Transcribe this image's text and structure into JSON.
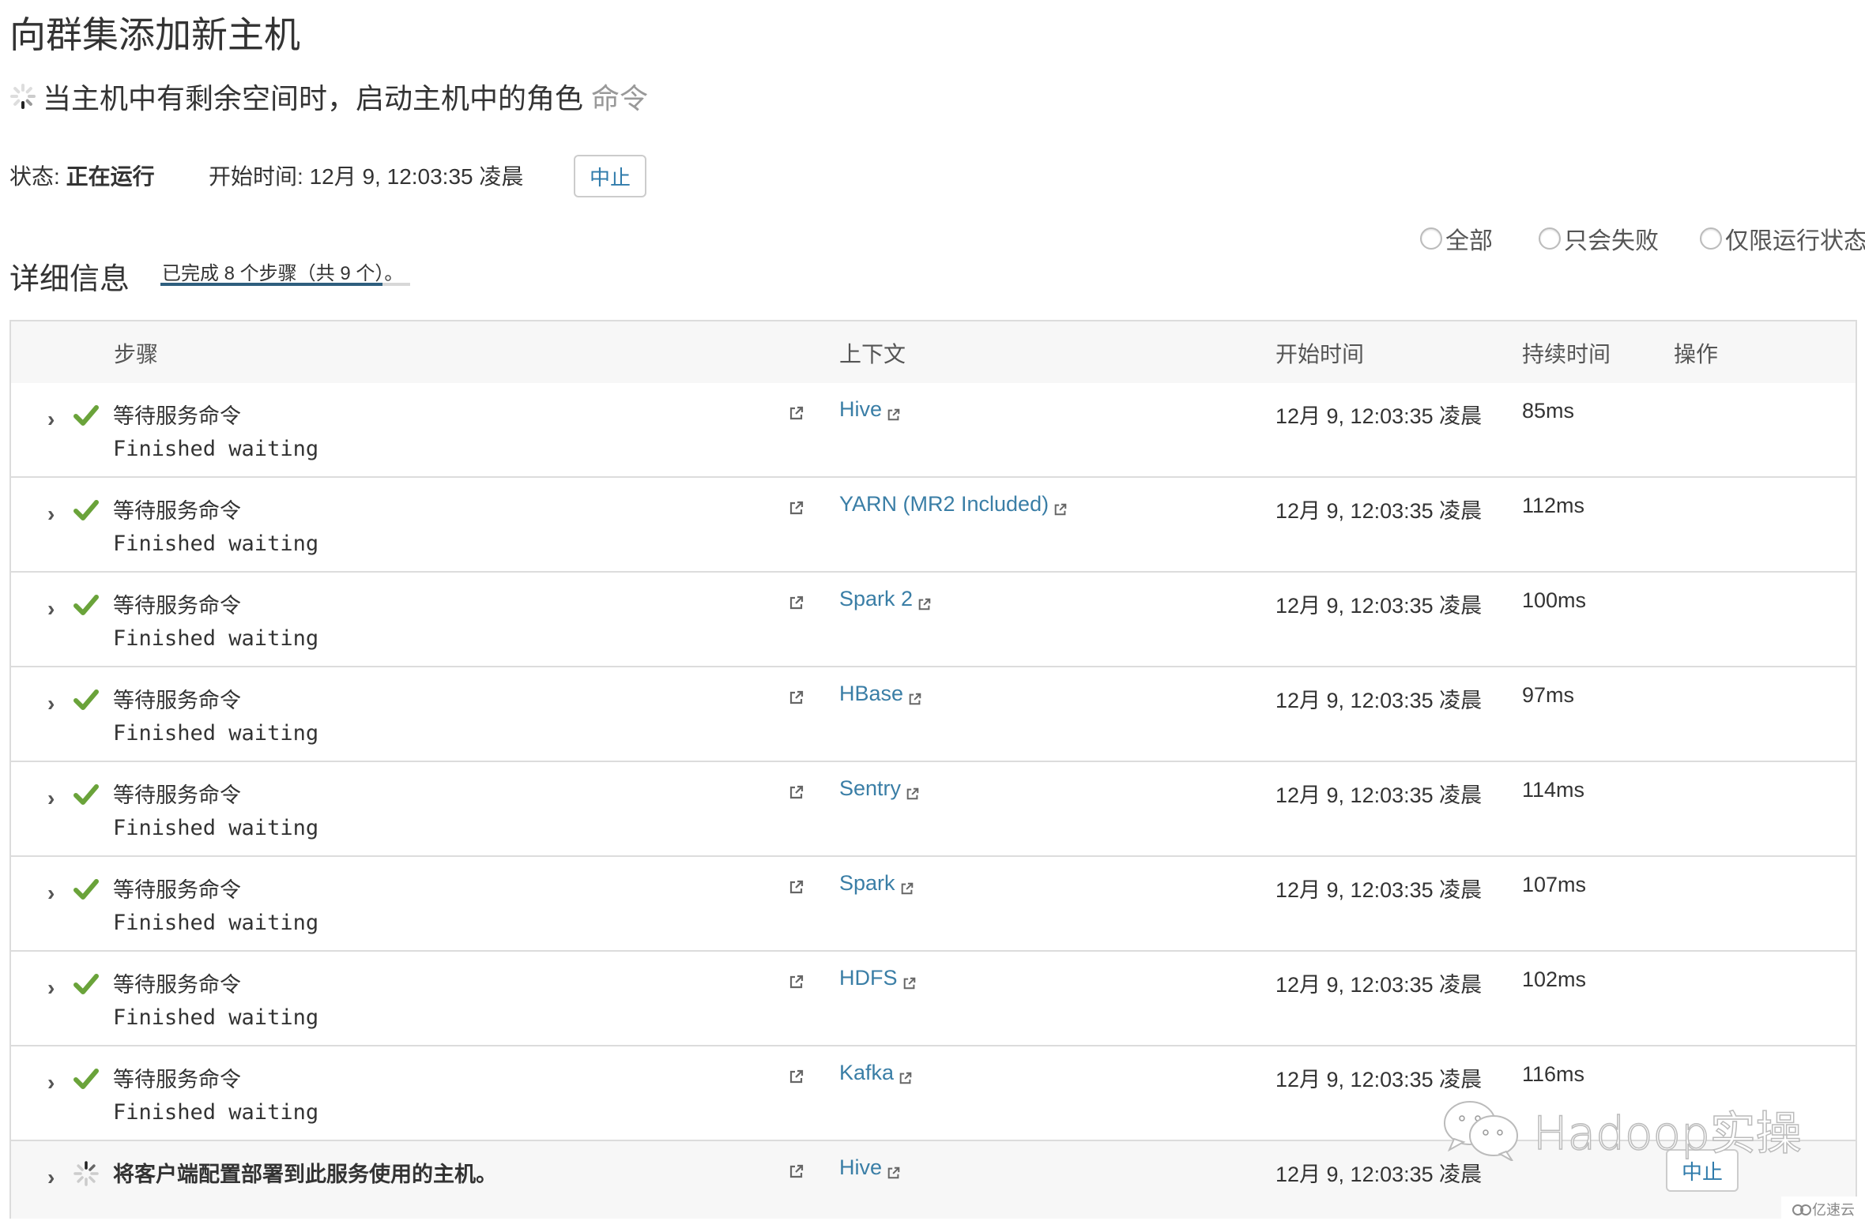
{
  "page": {
    "title": "向群集添加新主机",
    "command_title": "当主机中有剩余空间时，启动主机中的角色",
    "command_suffix": "命令"
  },
  "status": {
    "label": "状态:",
    "value": "正在运行",
    "start_label": "开始时间:",
    "start_value": "12月 9, 12:03:35 凌晨",
    "stop_button": "中止"
  },
  "filters": {
    "options": [
      {
        "label": "全部",
        "selected": false
      },
      {
        "label": "只会失败",
        "selected": false
      },
      {
        "label": "仅限运行状态",
        "selected": false
      }
    ]
  },
  "details": {
    "heading": "详细信息",
    "progress_text": "已完成 8 个步骤（共 9 个）。",
    "completed": 8,
    "total": 9
  },
  "table": {
    "headers": {
      "step": "步骤",
      "context": "上下文",
      "start_time": "开始时间",
      "duration": "持续时间",
      "actions": "操作"
    },
    "rows": [
      {
        "status": "success",
        "name": "等待服务命令",
        "message": "Finished waiting",
        "context": "Hive",
        "start": "12月 9, 12:03:35 凌晨",
        "duration": "85ms"
      },
      {
        "status": "success",
        "name": "等待服务命令",
        "message": "Finished waiting",
        "context": "YARN (MR2 Included)",
        "start": "12月 9, 12:03:35 凌晨",
        "duration": "112ms"
      },
      {
        "status": "success",
        "name": "等待服务命令",
        "message": "Finished waiting",
        "context": "Spark 2",
        "start": "12月 9, 12:03:35 凌晨",
        "duration": "100ms"
      },
      {
        "status": "success",
        "name": "等待服务命令",
        "message": "Finished waiting",
        "context": "HBase",
        "start": "12月 9, 12:03:35 凌晨",
        "duration": "97ms"
      },
      {
        "status": "success",
        "name": "等待服务命令",
        "message": "Finished waiting",
        "context": "Sentry",
        "start": "12月 9, 12:03:35 凌晨",
        "duration": "114ms"
      },
      {
        "status": "success",
        "name": "等待服务命令",
        "message": "Finished waiting",
        "context": "Spark",
        "start": "12月 9, 12:03:35 凌晨",
        "duration": "107ms"
      },
      {
        "status": "success",
        "name": "等待服务命令",
        "message": "Finished waiting",
        "context": "HDFS",
        "start": "12月 9, 12:03:35 凌晨",
        "duration": "102ms"
      },
      {
        "status": "success",
        "name": "等待服务命令",
        "message": "Finished waiting",
        "context": "Kafka",
        "start": "12月 9, 12:03:35 凌晨",
        "duration": "116ms"
      },
      {
        "status": "running",
        "name": "将客户端配置部署到此服务使用的主机。",
        "message": "",
        "context": "Hive",
        "start": "12月 9, 12:03:35 凌晨",
        "duration": "",
        "action": "中止"
      }
    ]
  },
  "watermark": {
    "text": "Hadoop实操",
    "logo_text": "亿速云"
  },
  "colors": {
    "link": "#3a7ea6",
    "success": "#6aa33a",
    "progress_fill": "#2e5e7e",
    "progress_track": "#d8d8d8"
  }
}
